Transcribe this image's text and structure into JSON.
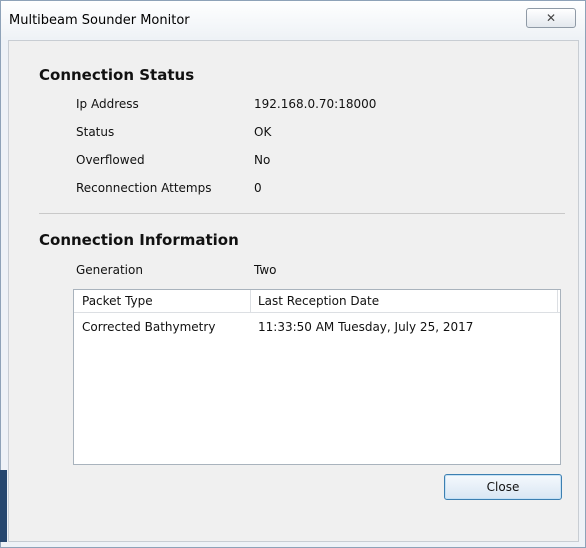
{
  "window": {
    "title": "Multibeam Sounder Monitor",
    "close_glyph": "✕"
  },
  "connection_status": {
    "heading": "Connection Status",
    "rows": [
      {
        "label": "Ip Address",
        "value": "192.168.0.70:18000"
      },
      {
        "label": "Status",
        "value": "OK"
      },
      {
        "label": "Overflowed",
        "value": "No"
      },
      {
        "label": "Reconnection Attemps",
        "value": "0"
      }
    ]
  },
  "connection_information": {
    "heading": "Connection Information",
    "generation_label": "Generation",
    "generation_value": "Two",
    "packet_list": {
      "columns": [
        "Packet Type",
        "Last Reception Date"
      ],
      "rows": [
        [
          "Corrected Bathymetry",
          "11:33:50 AM Tuesday, July 25, 2017"
        ]
      ]
    }
  },
  "buttons": {
    "close_label": "Close"
  }
}
